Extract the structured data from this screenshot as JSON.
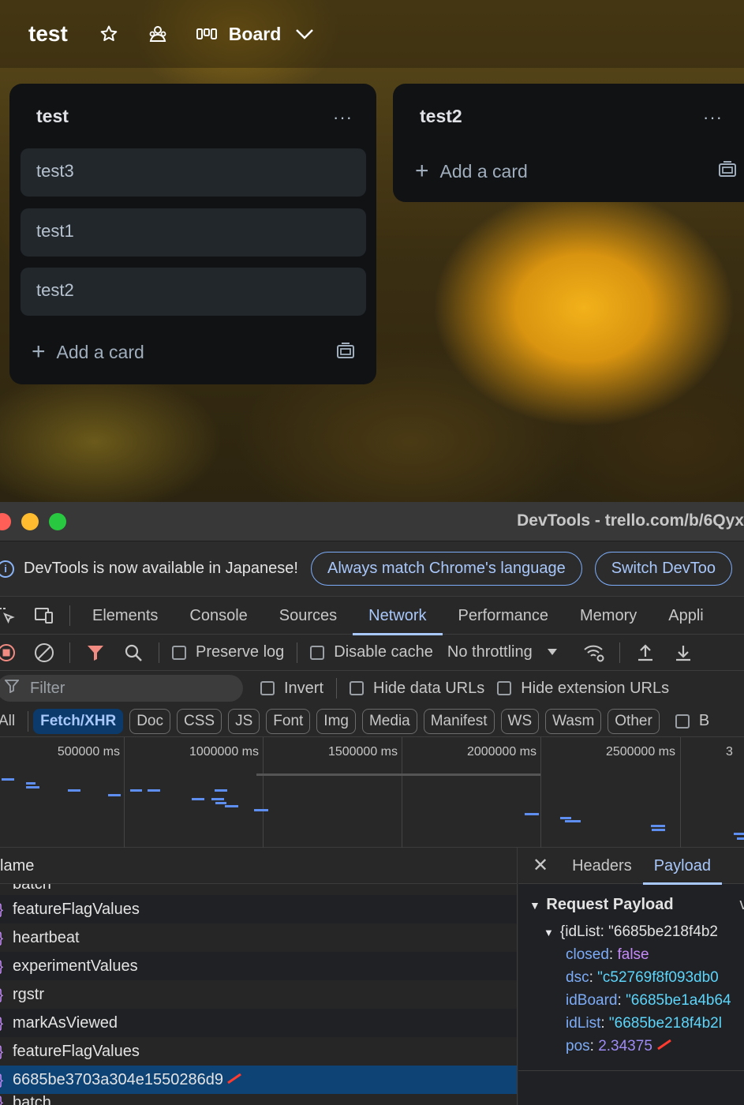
{
  "board": {
    "title": "test",
    "view_label": "Board",
    "lists": [
      {
        "title": "test",
        "menu": "···",
        "cards": [
          "test3",
          "test1",
          "test2"
        ],
        "add_card": "Add a card"
      },
      {
        "title": "test2",
        "menu": "···",
        "cards": [],
        "add_card": "Add a card"
      }
    ]
  },
  "devtools": {
    "window_title": "DevTools - trello.com/b/6Qyx",
    "infobar": {
      "message": "DevTools is now available in Japanese!",
      "btn_match": "Always match Chrome's language",
      "btn_switch": "Switch DevToo"
    },
    "tabs": [
      "Elements",
      "Console",
      "Sources",
      "Network",
      "Performance",
      "Memory",
      "Appli"
    ],
    "active_tab": "Network",
    "toolbar": {
      "preserve_log": "Preserve log",
      "disable_cache": "Disable cache",
      "throttling": "No throttling"
    },
    "filter": {
      "placeholder": "Filter",
      "invert": "Invert",
      "hide_data_urls": "Hide data URLs",
      "hide_extension_urls": "Hide extension URLs"
    },
    "type_filters": [
      "All",
      "Fetch/XHR",
      "Doc",
      "CSS",
      "JS",
      "Font",
      "Img",
      "Media",
      "Manifest",
      "WS",
      "Wasm",
      "Other"
    ],
    "type_filter_overflow": "B",
    "active_type_filter": "Fetch/XHR",
    "timeline_labels": [
      "500000 ms",
      "1000000 ms",
      "1500000 ms",
      "2000000 ms",
      "2500000 ms",
      "3"
    ],
    "request_list": {
      "column_name": "lame",
      "partial_top": "batch",
      "rows": [
        "featureFlagValues",
        "heartbeat",
        "experimentValues",
        "rgstr",
        "markAsViewed",
        "featureFlagValues",
        "6685be3703a304e1550286d9",
        "batch"
      ],
      "selected_index": 6
    },
    "detail": {
      "close": "✕",
      "tabs": [
        "Headers",
        "Payload"
      ],
      "active_tab": "Payload",
      "payload_title": "Request Payload",
      "view_source": "vie",
      "root_line": "{idList: \"6685be218f4b2",
      "fields": [
        {
          "key": "closed",
          "value": "false",
          "kind": "bool"
        },
        {
          "key": "dsc",
          "value": "\"c52769f8f093db0",
          "kind": "str"
        },
        {
          "key": "idBoard",
          "value": "\"6685be1a4b64",
          "kind": "str"
        },
        {
          "key": "idList",
          "value": "\"6685be218f4b2l",
          "kind": "str"
        },
        {
          "key": "pos",
          "value": "2.34375",
          "kind": "num"
        }
      ]
    }
  }
}
